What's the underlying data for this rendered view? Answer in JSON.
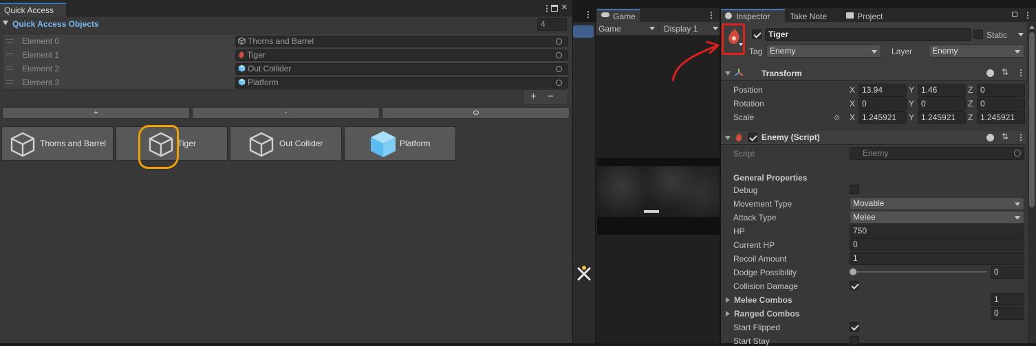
{
  "quick_access": {
    "tab": "Quick Access",
    "list_title": "Quick Access Objects",
    "count": "4",
    "elements": [
      {
        "name": "Element 0",
        "value": "Thorns and Barrel"
      },
      {
        "name": "Element 1",
        "value": "Tiger"
      },
      {
        "name": "Element 2",
        "value": "Out Collider"
      },
      {
        "name": "Element 3",
        "value": "Platform"
      }
    ],
    "add_label": "+",
    "remove_label": "−",
    "toolbar_plus": "+",
    "toolbar_minus": "-",
    "tiles": [
      "Thorns and Barrel",
      "Tiger",
      "Out Collider",
      "Platform"
    ]
  },
  "game": {
    "tab": "Game",
    "mode": "Game",
    "display": "Display 1"
  },
  "tabs": {
    "inspector": "Inspector",
    "take_note": "Take Note",
    "project": "Project"
  },
  "object": {
    "name": "Tiger",
    "static_label": "Static",
    "tag_label": "Tag",
    "tag": "Enemy",
    "layer_label": "Layer",
    "layer": "Enemy"
  },
  "transform": {
    "title": "Transform",
    "rows": [
      {
        "label": "Position",
        "x": "13.94",
        "y": "1.46",
        "z": "0"
      },
      {
        "label": "Rotation",
        "x": "0",
        "y": "0",
        "z": "0"
      },
      {
        "label": "Scale",
        "x": "1.245921",
        "y": "1.245921",
        "z": "1.245921"
      }
    ],
    "axis": {
      "x": "X",
      "y": "Y",
      "z": "Z"
    }
  },
  "enemy": {
    "title": "Enemy (Script)",
    "script_label": "Script",
    "script_value": "Enemy",
    "section": "General Properties",
    "debug": "Debug",
    "movement_type": "Movement Type",
    "movement_value": "Movable",
    "attack_type": "Attack Type",
    "attack_value": "Melee",
    "hp": "HP",
    "hp_value": "750",
    "current_hp": "Current HP",
    "current_hp_value": "0",
    "recoil": "Recoil Amount",
    "recoil_value": "1",
    "dodge": "Dodge Possibility",
    "dodge_value": "0",
    "dodge_level": 0,
    "collision": "Collision Damage",
    "melee": "Melee Combos",
    "melee_value": "1",
    "ranged": "Ranged Combos",
    "ranged_value": "0",
    "start_flipped": "Start Flipped",
    "start_stay": "Start Stay"
  },
  "colors": {
    "annotation_red": "#e0211b",
    "annotation_orange": "#f0a100",
    "accent_blue": "#7ab8f5"
  }
}
